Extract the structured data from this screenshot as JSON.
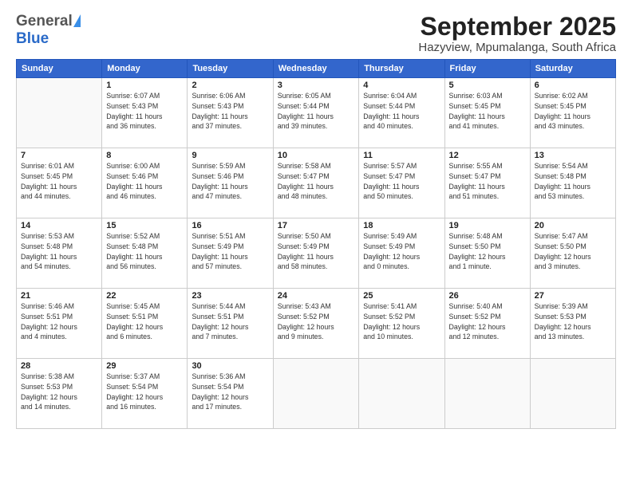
{
  "header": {
    "logo_general": "General",
    "logo_blue": "Blue",
    "title": "September 2025",
    "subtitle": "Hazyview, Mpumalanga, South Africa"
  },
  "weekdays": [
    "Sunday",
    "Monday",
    "Tuesday",
    "Wednesday",
    "Thursday",
    "Friday",
    "Saturday"
  ],
  "weeks": [
    [
      {
        "day": "",
        "info": ""
      },
      {
        "day": "1",
        "info": "Sunrise: 6:07 AM\nSunset: 5:43 PM\nDaylight: 11 hours\nand 36 minutes."
      },
      {
        "day": "2",
        "info": "Sunrise: 6:06 AM\nSunset: 5:43 PM\nDaylight: 11 hours\nand 37 minutes."
      },
      {
        "day": "3",
        "info": "Sunrise: 6:05 AM\nSunset: 5:44 PM\nDaylight: 11 hours\nand 39 minutes."
      },
      {
        "day": "4",
        "info": "Sunrise: 6:04 AM\nSunset: 5:44 PM\nDaylight: 11 hours\nand 40 minutes."
      },
      {
        "day": "5",
        "info": "Sunrise: 6:03 AM\nSunset: 5:45 PM\nDaylight: 11 hours\nand 41 minutes."
      },
      {
        "day": "6",
        "info": "Sunrise: 6:02 AM\nSunset: 5:45 PM\nDaylight: 11 hours\nand 43 minutes."
      }
    ],
    [
      {
        "day": "7",
        "info": "Sunrise: 6:01 AM\nSunset: 5:45 PM\nDaylight: 11 hours\nand 44 minutes."
      },
      {
        "day": "8",
        "info": "Sunrise: 6:00 AM\nSunset: 5:46 PM\nDaylight: 11 hours\nand 46 minutes."
      },
      {
        "day": "9",
        "info": "Sunrise: 5:59 AM\nSunset: 5:46 PM\nDaylight: 11 hours\nand 47 minutes."
      },
      {
        "day": "10",
        "info": "Sunrise: 5:58 AM\nSunset: 5:47 PM\nDaylight: 11 hours\nand 48 minutes."
      },
      {
        "day": "11",
        "info": "Sunrise: 5:57 AM\nSunset: 5:47 PM\nDaylight: 11 hours\nand 50 minutes."
      },
      {
        "day": "12",
        "info": "Sunrise: 5:55 AM\nSunset: 5:47 PM\nDaylight: 11 hours\nand 51 minutes."
      },
      {
        "day": "13",
        "info": "Sunrise: 5:54 AM\nSunset: 5:48 PM\nDaylight: 11 hours\nand 53 minutes."
      }
    ],
    [
      {
        "day": "14",
        "info": "Sunrise: 5:53 AM\nSunset: 5:48 PM\nDaylight: 11 hours\nand 54 minutes."
      },
      {
        "day": "15",
        "info": "Sunrise: 5:52 AM\nSunset: 5:48 PM\nDaylight: 11 hours\nand 56 minutes."
      },
      {
        "day": "16",
        "info": "Sunrise: 5:51 AM\nSunset: 5:49 PM\nDaylight: 11 hours\nand 57 minutes."
      },
      {
        "day": "17",
        "info": "Sunrise: 5:50 AM\nSunset: 5:49 PM\nDaylight: 11 hours\nand 58 minutes."
      },
      {
        "day": "18",
        "info": "Sunrise: 5:49 AM\nSunset: 5:49 PM\nDaylight: 12 hours\nand 0 minutes."
      },
      {
        "day": "19",
        "info": "Sunrise: 5:48 AM\nSunset: 5:50 PM\nDaylight: 12 hours\nand 1 minute."
      },
      {
        "day": "20",
        "info": "Sunrise: 5:47 AM\nSunset: 5:50 PM\nDaylight: 12 hours\nand 3 minutes."
      }
    ],
    [
      {
        "day": "21",
        "info": "Sunrise: 5:46 AM\nSunset: 5:51 PM\nDaylight: 12 hours\nand 4 minutes."
      },
      {
        "day": "22",
        "info": "Sunrise: 5:45 AM\nSunset: 5:51 PM\nDaylight: 12 hours\nand 6 minutes."
      },
      {
        "day": "23",
        "info": "Sunrise: 5:44 AM\nSunset: 5:51 PM\nDaylight: 12 hours\nand 7 minutes."
      },
      {
        "day": "24",
        "info": "Sunrise: 5:43 AM\nSunset: 5:52 PM\nDaylight: 12 hours\nand 9 minutes."
      },
      {
        "day": "25",
        "info": "Sunrise: 5:41 AM\nSunset: 5:52 PM\nDaylight: 12 hours\nand 10 minutes."
      },
      {
        "day": "26",
        "info": "Sunrise: 5:40 AM\nSunset: 5:52 PM\nDaylight: 12 hours\nand 12 minutes."
      },
      {
        "day": "27",
        "info": "Sunrise: 5:39 AM\nSunset: 5:53 PM\nDaylight: 12 hours\nand 13 minutes."
      }
    ],
    [
      {
        "day": "28",
        "info": "Sunrise: 5:38 AM\nSunset: 5:53 PM\nDaylight: 12 hours\nand 14 minutes."
      },
      {
        "day": "29",
        "info": "Sunrise: 5:37 AM\nSunset: 5:54 PM\nDaylight: 12 hours\nand 16 minutes."
      },
      {
        "day": "30",
        "info": "Sunrise: 5:36 AM\nSunset: 5:54 PM\nDaylight: 12 hours\nand 17 minutes."
      },
      {
        "day": "",
        "info": ""
      },
      {
        "day": "",
        "info": ""
      },
      {
        "day": "",
        "info": ""
      },
      {
        "day": "",
        "info": ""
      }
    ]
  ]
}
